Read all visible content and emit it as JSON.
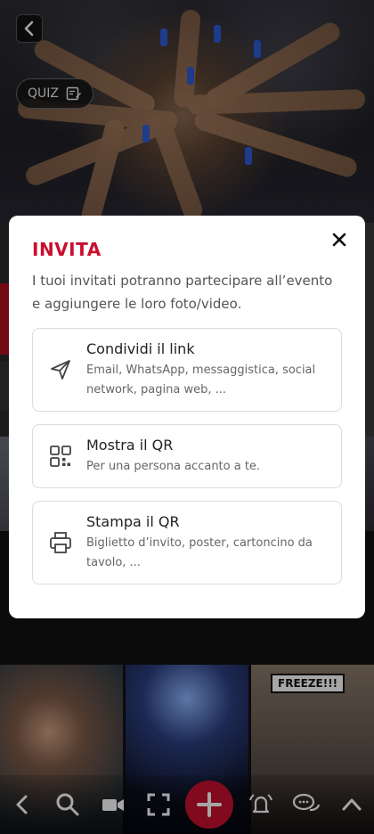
{
  "background": {
    "quiz_label": "QUIZ",
    "stickers": {
      "freeze_label": "FREEZE!!!"
    }
  },
  "modal": {
    "title": "INVITA",
    "description": "I tuoi invitati potranno partecipare all’evento e aggiungere le loro foto/video.",
    "options": [
      {
        "title": "Condividi il link",
        "subtitle": "Email, WhatsApp, messaggistica, social network, pagina web, ...",
        "icon": "send-icon"
      },
      {
        "title": "Mostra il QR",
        "subtitle": "Per una persona accanto a te.",
        "icon": "qr-code-icon"
      },
      {
        "title": "Stampa il QR",
        "subtitle": "Biglietto d’invito, poster, cartoncino da tavolo, ...",
        "icon": "printer-icon"
      }
    ]
  },
  "bottom_nav": {
    "icons": [
      "back-icon",
      "search-icon",
      "camera-icon",
      "fullscreen-icon",
      "add-icon",
      "bell-icon",
      "chat-icon",
      "chevron-up-icon"
    ]
  },
  "colors": {
    "accent": "#c8102e",
    "text_primary": "#222222",
    "text_secondary": "#666666",
    "border": "#dcdcdc"
  }
}
